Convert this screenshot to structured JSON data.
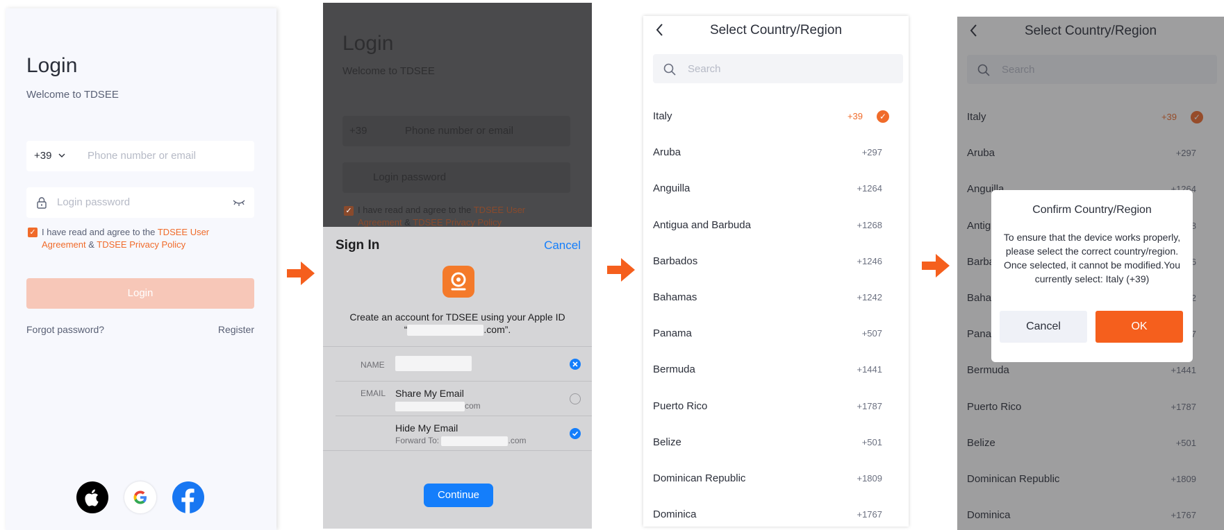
{
  "login": {
    "title": "Login",
    "subtitle": "Welcome to TDSEE",
    "country_code": "+39",
    "phone_placeholder": "Phone number or email",
    "password_placeholder": "Login password",
    "agree_prefix": "I have read and agree to the ",
    "agree_link1": "TDSEE User Agreement",
    "agree_and": " & ",
    "agree_link2": "TDSEE Privacy Policy",
    "login_button": "Login",
    "forgot": "Forgot password?",
    "register": "Register",
    "social": [
      "apple",
      "google",
      "facebook"
    ]
  },
  "apple_sheet": {
    "title": "Sign In",
    "cancel": "Cancel",
    "create_line1": "Create an account for TDSEE using your Apple ID",
    "create_line2_prefix": "“",
    "create_line2_suffix": ".com”.",
    "name_label": "NAME",
    "email_label": "EMAIL",
    "share_email": "Share My Email",
    "share_email_domain": "com",
    "hide_email": "Hide My Email",
    "forward_to": "Forward To:",
    "forward_domain": ".com",
    "continue": "Continue"
  },
  "country": {
    "title": "Select Country/Region",
    "search_placeholder": "Search",
    "items": [
      {
        "name": "Italy",
        "code": "+39"
      },
      {
        "name": "Aruba",
        "code": "+297"
      },
      {
        "name": "Anguilla",
        "code": "+1264"
      },
      {
        "name": "Antigua and Barbuda",
        "code": "+1268"
      },
      {
        "name": "Barbados",
        "code": "+1246"
      },
      {
        "name": "Bahamas",
        "code": "+1242"
      },
      {
        "name": "Panama",
        "code": "+507"
      },
      {
        "name": "Bermuda",
        "code": "+1441"
      },
      {
        "name": "Puerto Rico",
        "code": "+1787"
      },
      {
        "name": "Belize",
        "code": "+501"
      },
      {
        "name": "Dominican Republic",
        "code": "+1809"
      },
      {
        "name": "Dominica",
        "code": "+1767"
      }
    ]
  },
  "confirm": {
    "title": "Confirm Country/Region",
    "message": "To ensure that the device works properly, please select the correct country/region. Once selected, it cannot be modified.You currently select: Italy (+39)",
    "cancel": "Cancel",
    "ok": "OK"
  },
  "colors": {
    "accent": "#f06b2a",
    "apple_blue": "#147efb"
  }
}
